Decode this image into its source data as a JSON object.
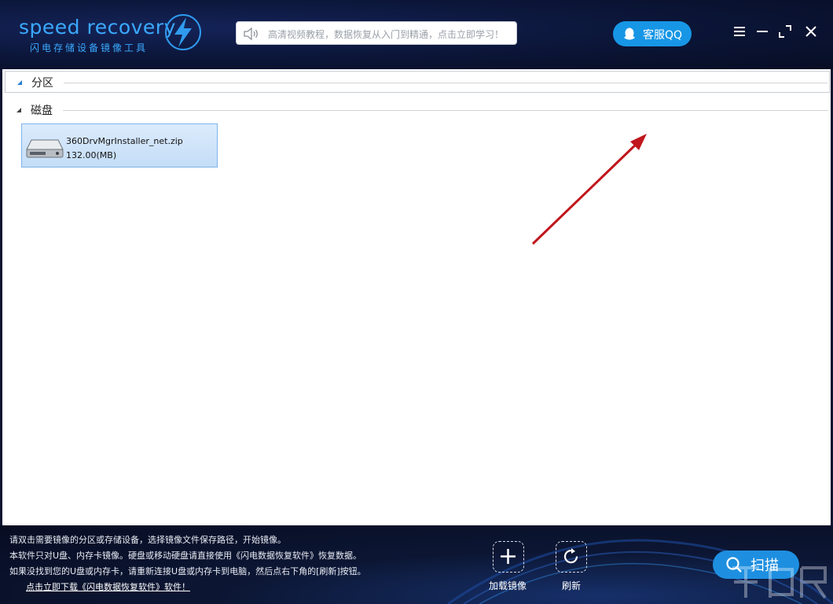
{
  "app": {
    "logo_text": "speed recovery",
    "logo_subtitle": "闪电存储设备镜像工具"
  },
  "header": {
    "notice_text": "高清视频教程，数据恢复从入门到精通，点击立即学习！",
    "qq_button_label": "客服QQ",
    "icons": [
      "speaker-icon",
      "qq-icon",
      "menu-icon",
      "minimize-icon",
      "maximize-icon",
      "close-icon"
    ]
  },
  "sections": {
    "partition_title": "分区",
    "disk_title": "磁盘"
  },
  "disks": [
    {
      "name": "360DrvMgrInstaller_net.zip",
      "size": "132.00(MB)"
    }
  ],
  "footer": {
    "hints": [
      "请双击需要镜像的分区或存储设备，选择镜像文件保存路径，开始镜像。",
      "本软件只对U盘、内存卡镜像。硬盘或移动硬盘请直接使用《闪电数据恢复软件》恢复数据。",
      "如果没找到您的U盘或内存卡，请重新连接U盘或内存卡到电脑，然后点右下角的[刷新]按钮。"
    ],
    "download_link": "点击立即下载《闪电数据恢复软件》软件！",
    "load_image_label": "加载镜像",
    "refresh_label": "刷新",
    "scan_label": "扫描"
  },
  "colors": {
    "accent": "#1e8fe0",
    "title_bg": "#0b1537",
    "selection_bg": "#cfe3fa",
    "annotation_arrow": "#c0161c"
  }
}
